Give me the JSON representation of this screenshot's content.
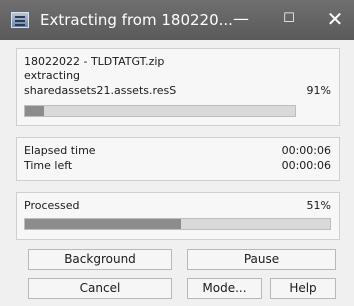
{
  "window": {
    "title": "Extracting from 180220...",
    "controls": {
      "minimize": "—",
      "maximize": "☐",
      "close": "✕"
    }
  },
  "file": {
    "archive": "18022022 - TLDTATGT.zip",
    "action": "extracting",
    "current_file": "sharedassets21.assets.resS",
    "percent_label": "91%",
    "progress": 0.07
  },
  "times": {
    "elapsed_label": "Elapsed time",
    "elapsed_value": "00:00:06",
    "left_label": "Time left",
    "left_value": "00:00:06"
  },
  "processed": {
    "label": "Processed",
    "percent_label": "51%",
    "progress": 0.51
  },
  "buttons": {
    "background": "Background",
    "pause": "Pause",
    "cancel": "Cancel",
    "mode": "Mode...",
    "help": "Help"
  }
}
